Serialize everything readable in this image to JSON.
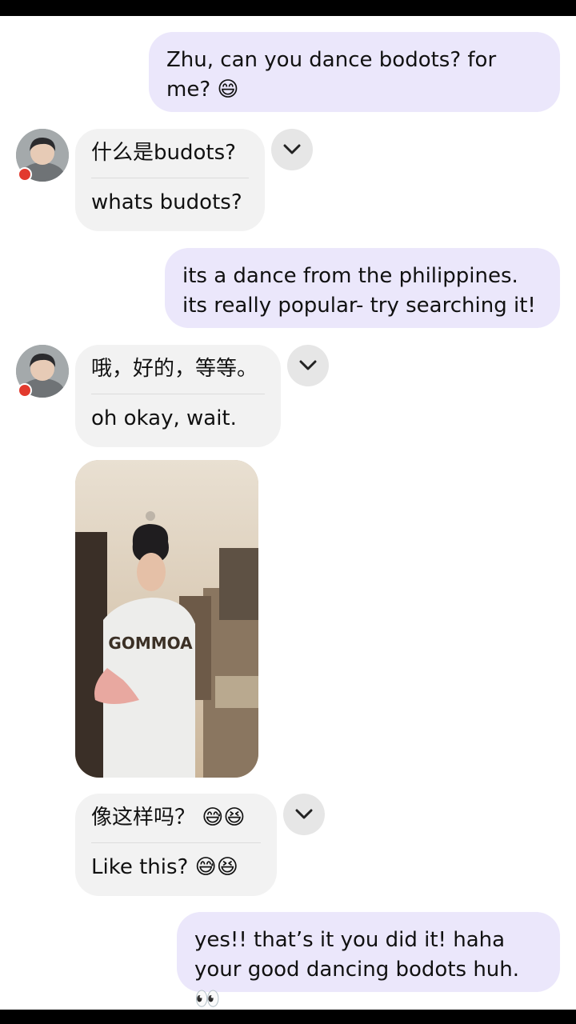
{
  "messages": [
    {
      "type": "outgoing",
      "text": "Zhu, can you dance bodots? for me? 😄"
    },
    {
      "type": "incoming",
      "original": "什么是budots?",
      "translation": "whats budots?"
    },
    {
      "type": "outgoing",
      "text": "its a dance from the philippines. its really popular- try searching it!"
    },
    {
      "type": "incoming",
      "original": "哦，好的，等等。",
      "translation": "oh okay, wait."
    },
    {
      "type": "video"
    },
    {
      "type": "incoming",
      "original": "像这样吗？ 😅😆",
      "translation": "Like this? 😅😆"
    },
    {
      "type": "outgoing",
      "text": "yes!! that’s it you did it! haha your good dancing bodots huh. 👀"
    }
  ],
  "contact": {
    "avatar": "avatar-photo",
    "badge_color": "#e23a2e"
  },
  "icons": {
    "expand": "chevron-down-icon"
  },
  "colors": {
    "outgoing_bubble": "#ebe7fb",
    "incoming_bubble": "#f2f2f2"
  }
}
